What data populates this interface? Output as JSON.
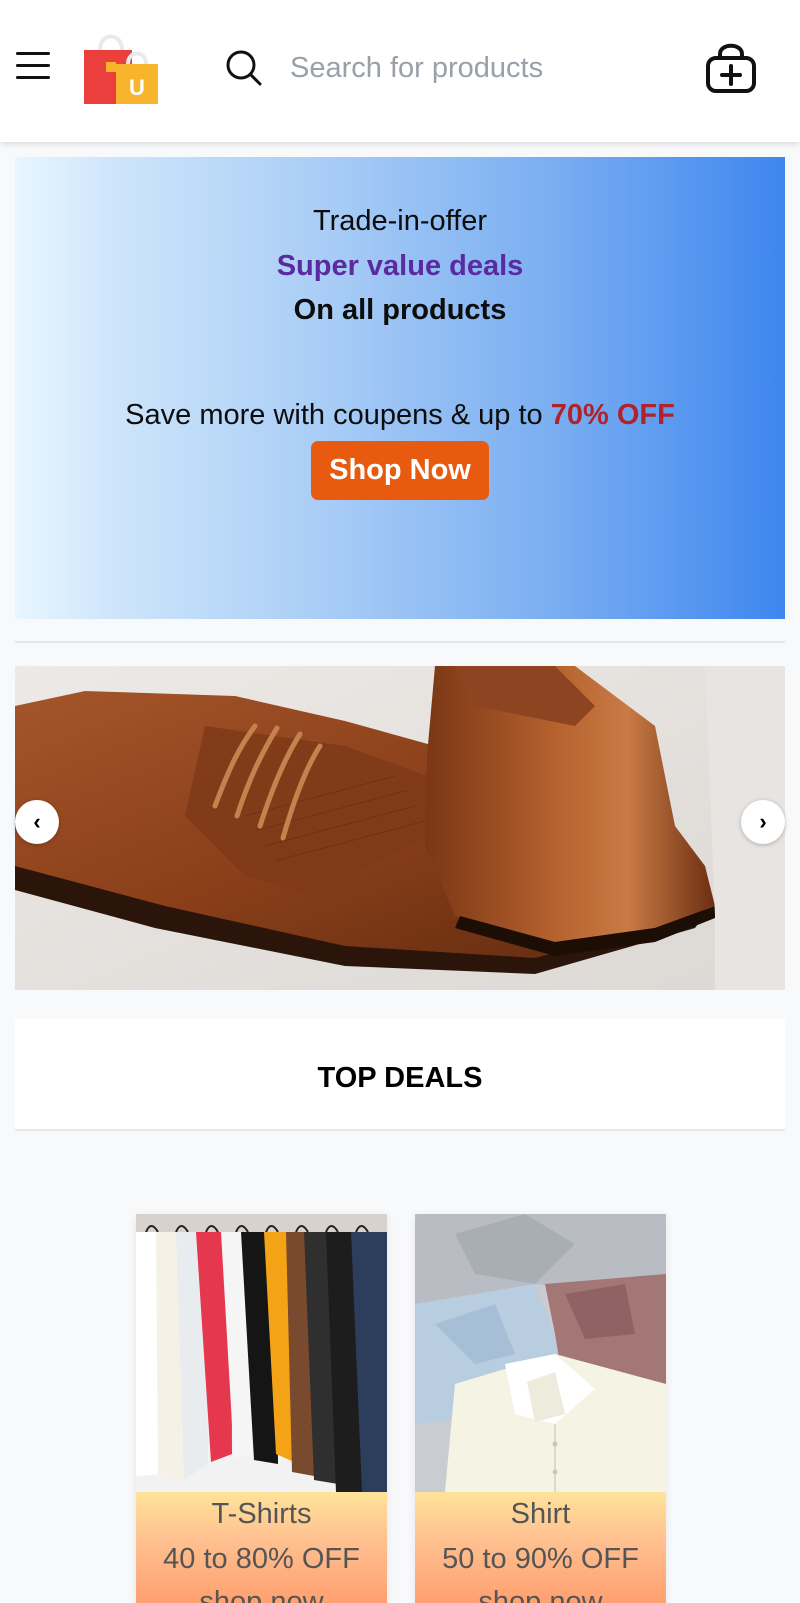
{
  "header": {
    "search_placeholder": "Search for products"
  },
  "hero": {
    "line1": "Trade-in-offer",
    "line2": "Super value deals",
    "line3": "On all products",
    "line4_prefix": "Save more with coupens & up to ",
    "line4_highlight": "70% OFF",
    "cta_label": "Shop Now"
  },
  "carousel": {
    "prev_label": "‹",
    "next_label": "›"
  },
  "deals": {
    "title": "TOP DEALS",
    "cards": [
      {
        "name": "T-Shirts",
        "offer": "40 to 80% OFF",
        "link": "shop now"
      },
      {
        "name": "Shirt",
        "offer": "50 to 90% OFF",
        "link": "shop now"
      }
    ]
  },
  "colors": {
    "accent_orange": "#e85a10",
    "deal_purple": "#5b2aa0",
    "highlight_red": "#b0232a"
  }
}
